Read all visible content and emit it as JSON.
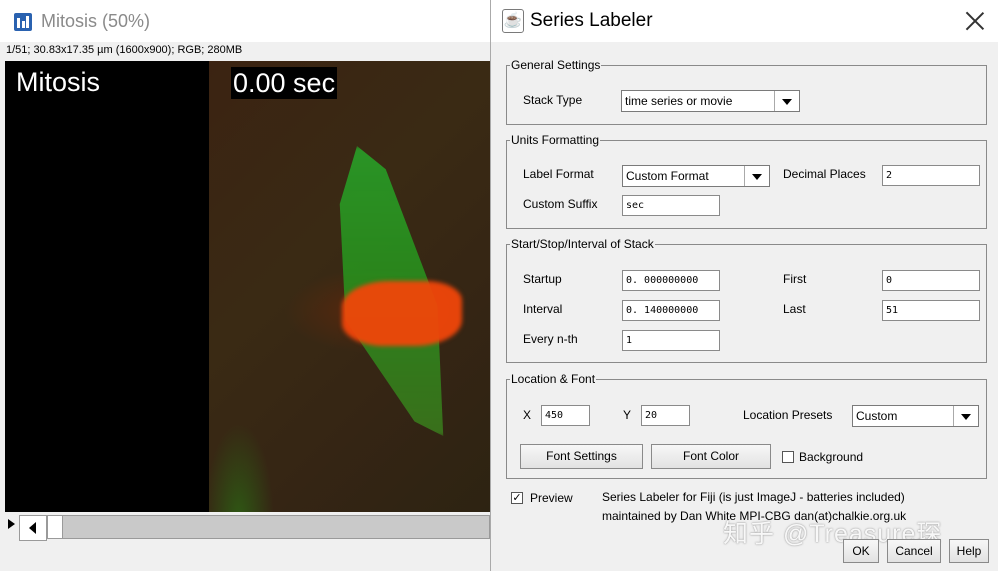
{
  "image_window": {
    "title": "Mitosis (50%)",
    "info": "1/51; 30.83x17.35 µm (1600x900); RGB; 280MB",
    "overlay_label": "Mitosis",
    "overlay_time": "0.00 sec"
  },
  "dialog": {
    "title": "Series Labeler",
    "general": {
      "legend": "General Settings",
      "stack_type_label": "Stack Type",
      "stack_type_value": "time series or movie"
    },
    "units": {
      "legend": "Units Formatting",
      "label_format_label": "Label Format",
      "label_format_value": "Custom Format",
      "decimal_places_label": "Decimal Places",
      "decimal_places_value": "2",
      "custom_suffix_label": "Custom Suffix",
      "custom_suffix_value": "sec"
    },
    "interval": {
      "legend": "Start/Stop/Interval of Stack",
      "startup_label": "Startup",
      "startup_value": "0. 000000000",
      "first_label": "First",
      "first_value": "0",
      "interval_label": "Interval",
      "interval_value": "0. 140000000",
      "last_label": "Last",
      "last_value": "51",
      "every_label": "Every n-th",
      "every_value": "1"
    },
    "location": {
      "legend": "Location & Font",
      "x_label": "X",
      "x_value": "450",
      "y_label": "Y",
      "y_value": "20",
      "presets_label": "Location Presets",
      "presets_value": "Custom",
      "font_settings": "Font Settings",
      "font_color": "Font Color",
      "background_label": "Background",
      "background_checked": false
    },
    "preview_label": "Preview",
    "preview_checked": true,
    "credit_line1": "Series Labeler for Fiji (is just ImageJ - batteries included)",
    "credit_line2": "maintained by Dan White MPI-CBG dan(at)chalkie.org.uk",
    "watermark": "知乎 @Treasure琛",
    "buttons": {
      "ok": "OK",
      "cancel": "Cancel",
      "help": "Help"
    }
  }
}
